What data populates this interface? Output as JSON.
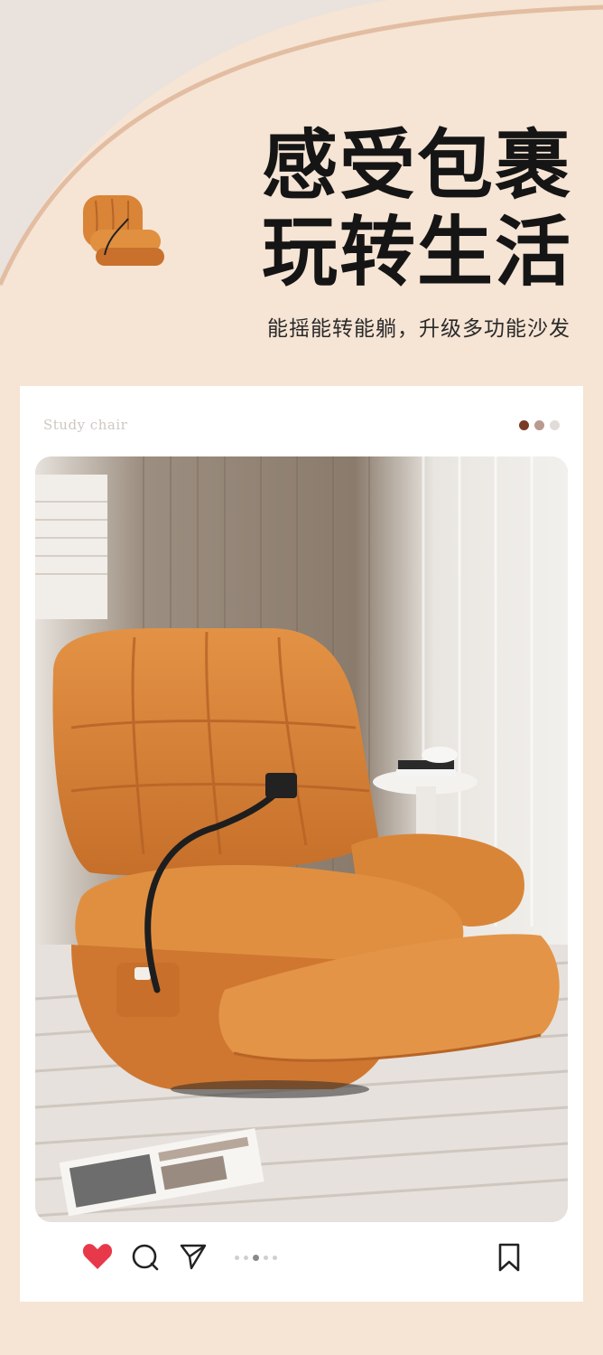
{
  "header": {
    "headline_line1": "感受包裹",
    "headline_line2": "玩转生活",
    "subtitle": "能摇能转能躺，升级多功能沙发"
  },
  "card": {
    "label": "Study chair",
    "indicator_colors": [
      "#7a3a26",
      "#b89a8e",
      "#e2dcd8"
    ],
    "pager_active_index": 2,
    "pager_count": 5
  },
  "actions": {
    "like_icon": "heart-icon",
    "comment_icon": "comment-icon",
    "share_icon": "send-icon",
    "bookmark_icon": "bookmark-icon",
    "like_color": "#e8394a"
  },
  "colors": {
    "background": "#f6e4d4",
    "accent_orange": "#d2782f",
    "arc": "#e2bda2"
  }
}
